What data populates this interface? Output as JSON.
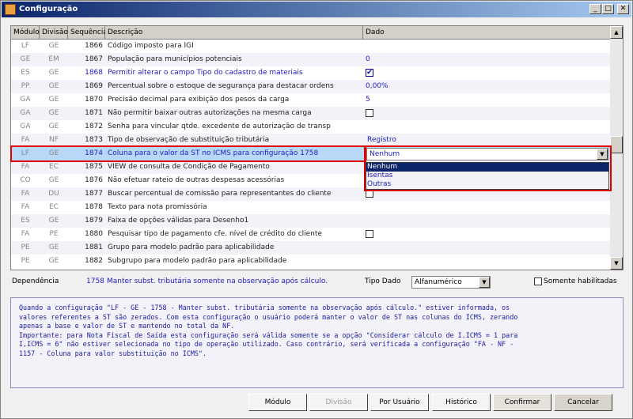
{
  "window": {
    "title": "Configuração",
    "min": "_",
    "max": "□",
    "close": "✕"
  },
  "grid": {
    "headers": [
      "Módulo",
      "Divisão",
      "Sequência",
      "Descrição",
      "Dado"
    ],
    "rows": [
      {
        "modulo": "LF",
        "divisao": "GE",
        "seq": "1866",
        "desc": "Código imposto para IGI",
        "dado": ""
      },
      {
        "modulo": "GE",
        "divisao": "EM",
        "seq": "1867",
        "desc": "População para municípios potenciais",
        "dado": "0"
      },
      {
        "modulo": "ES",
        "divisao": "GE",
        "seq": "1868",
        "desc": "Permitir alterar o campo Tipo do cadastro de materiais",
        "dado": "checked"
      },
      {
        "modulo": "PP",
        "divisao": "GE",
        "seq": "1869",
        "desc": "Percentual sobre o estoque de segurança para destacar ordens",
        "dado": "0,00%"
      },
      {
        "modulo": "GA",
        "divisao": "GE",
        "seq": "1870",
        "desc": "Precisão decimal para exibição dos pesos da carga",
        "dado": "5"
      },
      {
        "modulo": "GA",
        "divisao": "GE",
        "seq": "1871",
        "desc": "Não permitir baixar outras autorizações na mesma carga",
        "dado": "unchecked"
      },
      {
        "modulo": "GA",
        "divisao": "GE",
        "seq": "1872",
        "desc": "Senha para vincular qtde. excedente de autorização de transp",
        "dado": ""
      },
      {
        "modulo": "FA",
        "divisao": "NF",
        "seq": "1873",
        "desc": "Tipo de observação de substituição tributária",
        "dado": "Registro"
      },
      {
        "modulo": "LF",
        "divisao": "GE",
        "seq": "1874",
        "desc": "Coluna para o valor da ST no ICMS para configuração 1758",
        "dado": ""
      },
      {
        "modulo": "FA",
        "divisao": "EC",
        "seq": "1875",
        "desc": "VIEW de consulta de Condição de Pagamento",
        "dado": ""
      },
      {
        "modulo": "CO",
        "divisao": "GE",
        "seq": "1876",
        "desc": "Não efetuar rateio de outras despesas acessórias",
        "dado": ""
      },
      {
        "modulo": "FA",
        "divisao": "DU",
        "seq": "1877",
        "desc": "Buscar percentual de comissão para representantes do cliente",
        "dado": "unchecked"
      },
      {
        "modulo": "FA",
        "divisao": "EC",
        "seq": "1878",
        "desc": "Texto para nota promissória",
        "dado": ""
      },
      {
        "modulo": "ES",
        "divisao": "GE",
        "seq": "1879",
        "desc": "Faixa de opções válidas para Desenho1",
        "dado": ""
      },
      {
        "modulo": "FA",
        "divisao": "PE",
        "seq": "1880",
        "desc": "Pesquisar tipo de pagamento cfe. nível de crédito do cliente",
        "dado": "unchecked"
      },
      {
        "modulo": "PE",
        "divisao": "GE",
        "seq": "1881",
        "desc": "Grupo para modelo padrão para aplicabilidade",
        "dado": ""
      },
      {
        "modulo": "PE",
        "divisao": "GE",
        "seq": "1882",
        "desc": "Subgrupo para modelo padrão para aplicabilidade",
        "dado": ""
      }
    ],
    "combo": {
      "value": "Nenhum",
      "options": [
        "Nenhum",
        "Isentas",
        "Outras"
      ]
    }
  },
  "footer": {
    "dependencia_label": "Dependência",
    "dependencia_num": "1758",
    "dependencia_text": "Manter subst. tributária somente na observação após cálculo.",
    "tipo_dado_label": "Tipo Dado",
    "tipo_dado_value": "Alfanumérico",
    "somente_label": "Somente habilitadas",
    "memo": "Quando a configuração \"LF - GE - 1758 - Manter subst. tributária somente na observação após cálculo.\" estiver informada, os\nvalores referentes a ST são zerados. Com esta configuração o usuário poderá manter o valor de ST nas colunas do ICMS, zerando\napenas a base e valor de ST e mantendo no total da NF.\nImportante: para Nota Fiscal de Saída esta configuração será válida somente se a opção \"Considerar cálculo de I.ICMS = 1 para\nI,ICMS = 6\" não estiver selecionada no tipo de operação utilizado. Caso contrário, será verificada a configuração \"FA - NF -\n1157 - Coluna para valor substituição no ICMS\"."
  },
  "buttons": {
    "modulo": "Módulo",
    "divisao": "Divisão",
    "por_usuario": "Por Usuário",
    "historico": "Histórico",
    "confirmar": "Confirmar",
    "cancelar": "Cancelar"
  }
}
